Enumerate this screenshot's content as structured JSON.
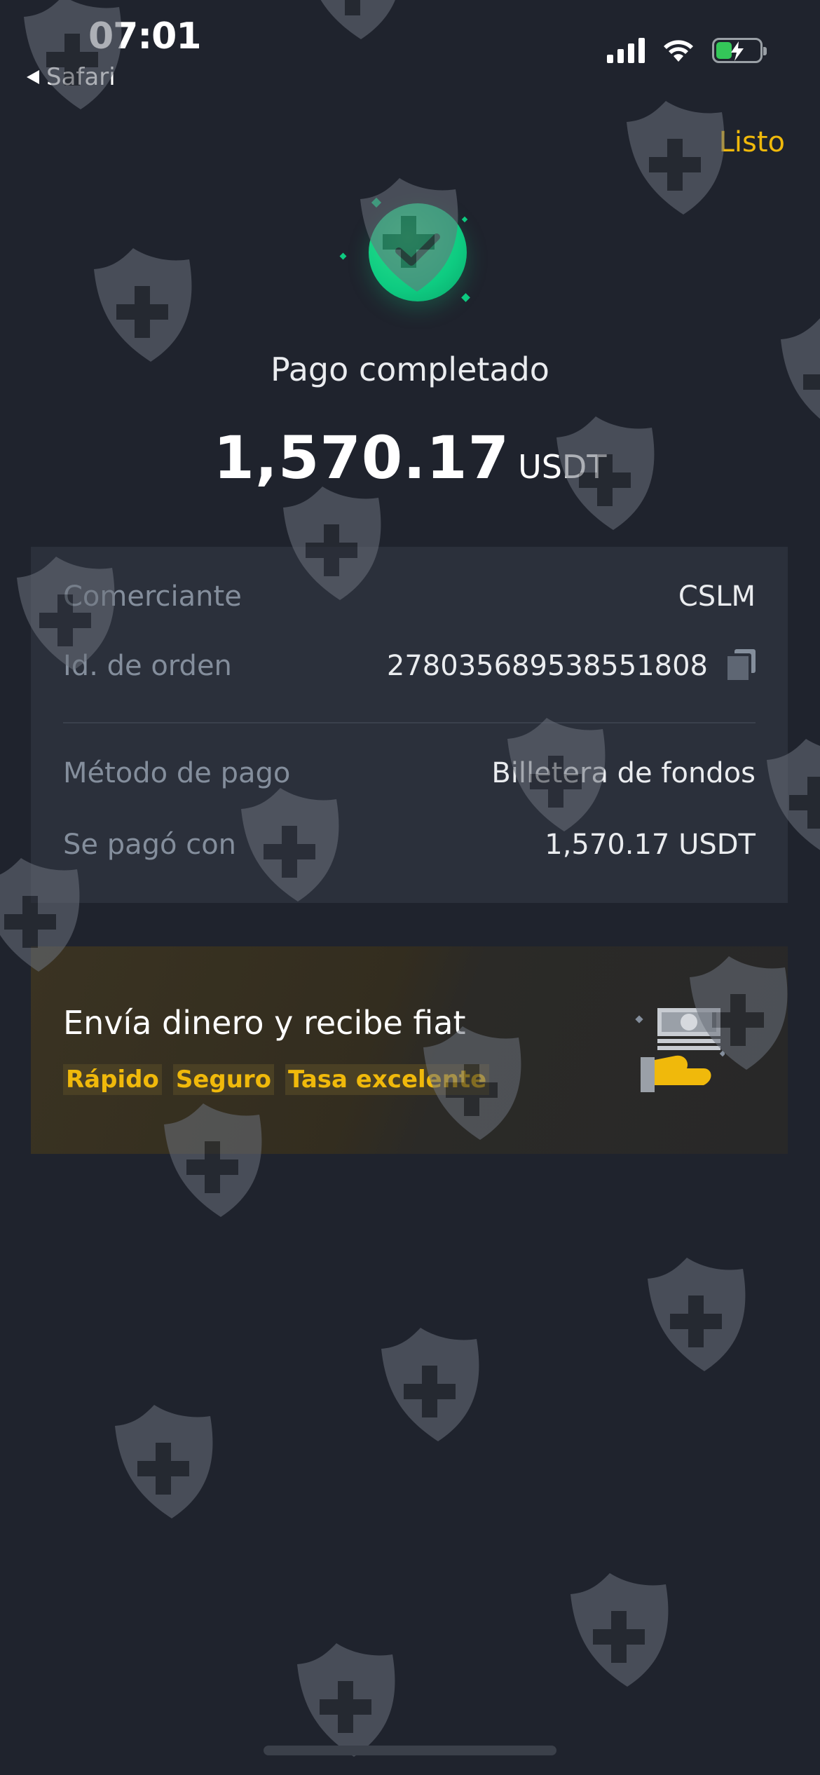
{
  "status_bar": {
    "time": "07:01",
    "back_app": "Safari"
  },
  "header": {
    "done_label": "Listo"
  },
  "result": {
    "title": "Pago completado",
    "amount": "1,570.17",
    "currency": "USDT",
    "status_color": "#0ecb81"
  },
  "details": {
    "merchant": {
      "label": "Comerciante",
      "value": "CSLM"
    },
    "order_id": {
      "label": "Id. de orden",
      "value": "278035689538551808"
    },
    "payment_method": {
      "label": "Método de pago",
      "value": "Billetera de fondos"
    },
    "paid_with": {
      "label": "Se pagó con",
      "value": "1,570.17 USDT"
    }
  },
  "promo": {
    "title": "Envía dinero y recibe fiat",
    "tags": [
      "Rápido",
      "Seguro",
      "Tasa excelente"
    ],
    "accent_color": "#f0b90b"
  },
  "icons": [
    "signal-icon",
    "wifi-icon",
    "battery-charging-icon",
    "check-circle-icon",
    "copy-icon",
    "cash-hand-icon",
    "shield-watermark-icon"
  ]
}
